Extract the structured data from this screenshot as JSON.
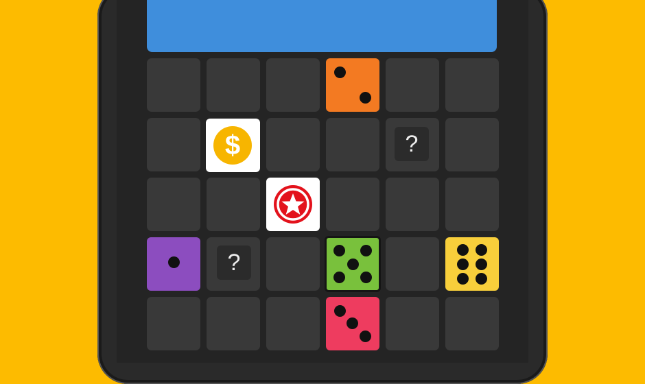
{
  "header": {
    "color": "#3F8EDC"
  },
  "board": {
    "rows": 5,
    "cols": 6,
    "colors": {
      "background": "#FDBB00",
      "cell": "#393939",
      "orange": "#F37A22",
      "purple": "#8C4DBF",
      "green": "#79C13C",
      "yellow": "#F8CF3B",
      "red": "#EE3C5F"
    }
  },
  "tiles": {
    "coin": {
      "symbol": "$",
      "icon": "dollar-coin-icon"
    },
    "star": {
      "icon": "star-icon"
    },
    "mystery_a": {
      "symbol": "?"
    },
    "mystery_b": {
      "symbol": "?"
    }
  },
  "dice": [
    {
      "name": "orange-die",
      "value": 2
    },
    {
      "name": "purple-die",
      "value": 1
    },
    {
      "name": "green-die",
      "value": 5
    },
    {
      "name": "yellow-die",
      "value": 6
    },
    {
      "name": "red-die",
      "value": 3
    }
  ]
}
